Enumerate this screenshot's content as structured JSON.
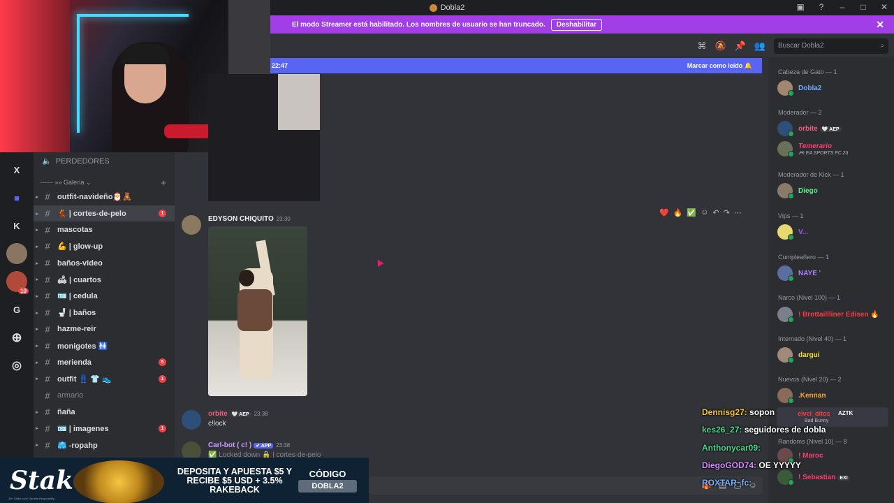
{
  "window": {
    "title": "Dobla2"
  },
  "banner": {
    "text": "El modo Streamer está habilitado. Los nombres de usuario se han truncado.",
    "button": "Deshabilitar"
  },
  "rail": {
    "items": [
      "X",
      "K",
      "G"
    ],
    "badge": "10"
  },
  "sidebar": {
    "category": "PERDEDORES",
    "gallery": "------ »» Galería ⌄",
    "channels": [
      {
        "name": "outfit-navideño🎅🧸",
        "badge": ""
      },
      {
        "name": "💃 | cortes-de-pelo",
        "badge": "1",
        "active": true
      },
      {
        "name": "mascotas",
        "badge": ""
      },
      {
        "name": "💪 | glow-up",
        "badge": ""
      },
      {
        "name": "baños-video",
        "badge": ""
      },
      {
        "name": "🛋 | cuartos",
        "badge": ""
      },
      {
        "name": "🪪 | cedula",
        "badge": ""
      },
      {
        "name": "🚽 | baños",
        "badge": ""
      },
      {
        "name": "hazme-reir",
        "badge": ""
      },
      {
        "name": "monigotes 🚻",
        "badge": ""
      },
      {
        "name": "merienda",
        "badge": "5"
      },
      {
        "name": "outfit 👖 👕 👟",
        "badge": "1"
      },
      {
        "name": "armario",
        "badge": "",
        "muted": true
      },
      {
        "name": "ñaña",
        "badge": ""
      },
      {
        "name": "🪪 | imagenes",
        "badge": "1"
      },
      {
        "name": "🩳 -ropahp",
        "badge": ""
      }
    ]
  },
  "header": {
    "search_placeholder": "Buscar Dobla2"
  },
  "newbar": {
    "time": "22:47",
    "mark_read": "Marcar como leído"
  },
  "messages": {
    "m1": {
      "author": "EDYSON CHIQUITO",
      "time": "23:30"
    },
    "m2": {
      "author": "orbite",
      "tag": "🤍 AEP",
      "time": "23:38",
      "text": "c!lock"
    },
    "m3": {
      "author": "Carl-bot ( c! )",
      "tag": "✔ APP",
      "time": "23:38",
      "text": "✅ Locked down 🔒 | cortes-de-pelo"
    }
  },
  "reactions": [
    "❤️",
    "🔥",
    "✅"
  ],
  "members": {
    "groups": [
      {
        "label": "Cabeza de Gato — 1"
      },
      {
        "label": "Moderador — 2"
      },
      {
        "label": "Moderador de Kick — 1"
      },
      {
        "label": "Vips — 1"
      },
      {
        "label": "Cumpleañero — 1"
      },
      {
        "label": "Narco (Nivel 100) — 1"
      },
      {
        "label": "Internado (Nivel 40) — 1"
      },
      {
        "label": "Nuevos (Nivel 20) — 2"
      },
      {
        "label": "Randoms (Nivel 10) — 8"
      }
    ],
    "list": [
      {
        "name": "Dobla2",
        "color": "#6ea8ff"
      },
      {
        "name": "orbite",
        "tag": "🤍 AEP",
        "color": "#f25c7a"
      },
      {
        "name": "Temerario",
        "sub": "🎮 EA SPORTS FC 26",
        "color": "#ff3f6c"
      },
      {
        "name": "Diego",
        "color": "#57f287"
      },
      {
        "name": "V...",
        "color": "#b04dff"
      },
      {
        "name": "NAYE '",
        "color": "#b07dff"
      },
      {
        "name": "! Brottaillliner Edisen 🔥",
        "color": "#ff3b3b"
      },
      {
        "name": "dargui",
        "color": "#f5e027"
      },
      {
        "name": ".Kennan",
        "color": "#f0a640"
      },
      {
        "name": "! Maroc",
        "color": "#ff3b6b"
      },
      {
        "name": "! Sebastian",
        "tag": "EXI",
        "color": "#ff3b6b"
      }
    ]
  },
  "overlay_chat": [
    {
      "user": "Dennisg27:",
      "msg": "sopon",
      "color": "#f5c542"
    },
    {
      "user": "kes26_27:",
      "msg": "seguidores de dobla",
      "color": "#4ad98f"
    },
    {
      "user": "Anthonycar09:",
      "msg": "",
      "color": "#4ad98f"
    },
    {
      "user": "DiegoGOD74:",
      "msg": "OE YYYYY",
      "color": "#d38cff"
    },
    {
      "user": "ROXTAR_fc:",
      "msg": "",
      "color": "#6fb2ff"
    }
  ],
  "overlay_extra": {
    "name": "elvel_ditos",
    "tag": "AZTK",
    "sub": "Bad Bunny"
  },
  "stake": {
    "logo": "Stake",
    "logo_sub": "18+ Stake.com/ Gamble Responsibly",
    "promo": "DEPOSITA Y APUESTA $5 Y RECIBE $5 USD + 3.5% RAKEBACK",
    "code_label": "CÓDIGO",
    "code": "DOBLA2"
  }
}
